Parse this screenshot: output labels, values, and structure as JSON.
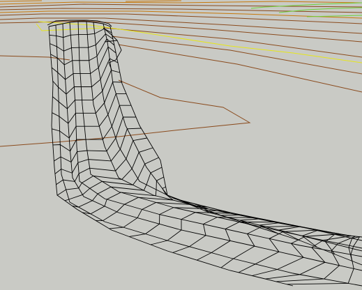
{
  "viewport": {
    "background": "#c9cac5",
    "wire_color": "#000000",
    "terrain_colors": {
      "contour_brown": "#8a4a1c",
      "contour_orange": "#c8780a",
      "contour_yellow": "#e6e619",
      "contour_green": "#6fd23c"
    }
  }
}
